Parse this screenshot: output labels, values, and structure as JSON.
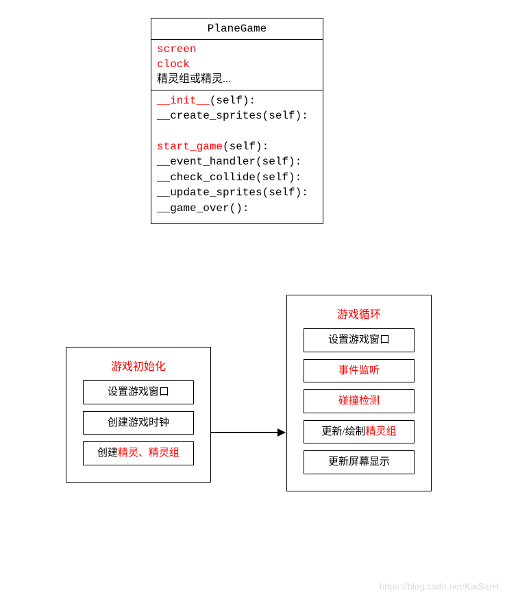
{
  "uml": {
    "title": "PlaneGame",
    "attrs": [
      {
        "text": "screen",
        "cls": "red mono"
      },
      {
        "text": "clock",
        "cls": "red mono"
      },
      {
        "text": "精灵组或精灵...",
        "cls": "black"
      }
    ],
    "methods": [
      [
        {
          "text": "__init__",
          "cls": "red mono"
        },
        {
          "text": "(self):",
          "cls": "black mono"
        }
      ],
      [
        {
          "text": "__create_sprites(self):",
          "cls": "black mono"
        }
      ],
      [
        {
          "text": "",
          "cls": "black mono"
        }
      ],
      [
        {
          "text": "start_game",
          "cls": "red mono"
        },
        {
          "text": "(self):",
          "cls": "black mono"
        }
      ],
      [
        {
          "text": "__event_handler(self):",
          "cls": "black mono"
        }
      ],
      [
        {
          "text": "__check_collide(self):",
          "cls": "black mono"
        }
      ],
      [
        {
          "text": "__update_sprites(self):",
          "cls": "black mono"
        }
      ],
      [
        {
          "text": "__game_over():",
          "cls": "black mono"
        }
      ]
    ]
  },
  "flow": {
    "left": {
      "title": "游戏初始化",
      "items": [
        [
          {
            "text": "设置游戏窗口",
            "cls": "black"
          }
        ],
        [
          {
            "text": "创建游戏时钟",
            "cls": "black"
          }
        ],
        [
          {
            "text": "创建",
            "cls": "black"
          },
          {
            "text": "精灵、精灵组",
            "cls": "red"
          }
        ]
      ]
    },
    "right": {
      "title": "游戏循环",
      "items": [
        [
          {
            "text": "设置游戏窗口",
            "cls": "black"
          }
        ],
        [
          {
            "text": "事件监听",
            "cls": "red"
          }
        ],
        [
          {
            "text": "碰撞检测",
            "cls": "red"
          }
        ],
        [
          {
            "text": "更新/绘制",
            "cls": "black"
          },
          {
            "text": "精灵组",
            "cls": "red"
          }
        ],
        [
          {
            "text": "更新屏幕显示",
            "cls": "black"
          }
        ]
      ]
    }
  },
  "watermark": "https://blog.csdn.net/KaiSarH"
}
